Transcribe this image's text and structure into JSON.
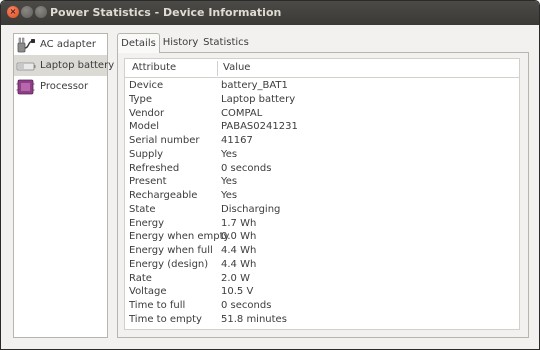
{
  "window": {
    "title": "Power Statistics - Device Information",
    "close_glyph": "×"
  },
  "sidebar": {
    "items": [
      {
        "label": "AC adapter",
        "icon": "ac-adapter-icon"
      },
      {
        "label": "Laptop battery",
        "icon": "laptop-battery-icon",
        "selected": true
      },
      {
        "label": "Processor",
        "icon": "processor-icon"
      }
    ]
  },
  "tabs": [
    {
      "label": "Details",
      "active": true
    },
    {
      "label": "History"
    },
    {
      "label": "Statistics"
    }
  ],
  "details": {
    "columns": [
      "Attribute",
      "Value"
    ],
    "rows": [
      {
        "attribute": "Device",
        "value": "battery_BAT1"
      },
      {
        "attribute": "Type",
        "value": "Laptop battery"
      },
      {
        "attribute": "Vendor",
        "value": "COMPAL"
      },
      {
        "attribute": "Model",
        "value": "PABAS0241231"
      },
      {
        "attribute": "Serial number",
        "value": "41167"
      },
      {
        "attribute": "Supply",
        "value": "Yes"
      },
      {
        "attribute": "Refreshed",
        "value": "0 seconds"
      },
      {
        "attribute": "Present",
        "value": "Yes"
      },
      {
        "attribute": "Rechargeable",
        "value": "Yes"
      },
      {
        "attribute": "State",
        "value": "Discharging"
      },
      {
        "attribute": "Energy",
        "value": "1.7 Wh"
      },
      {
        "attribute": "Energy when empty",
        "value": "0.0 Wh"
      },
      {
        "attribute": "Energy when full",
        "value": "4.4 Wh"
      },
      {
        "attribute": "Energy (design)",
        "value": "4.4 Wh"
      },
      {
        "attribute": "Rate",
        "value": "2.0 W"
      },
      {
        "attribute": "Voltage",
        "value": "10.5 V"
      },
      {
        "attribute": "Time to full",
        "value": "0 seconds"
      },
      {
        "attribute": "Time to empty",
        "value": "51.8 minutes"
      }
    ]
  },
  "colors": {
    "titlebar": "#3b3a36",
    "close": "#df4a16",
    "window_bg": "#f2f1f0",
    "selection": "#dcdad5"
  }
}
